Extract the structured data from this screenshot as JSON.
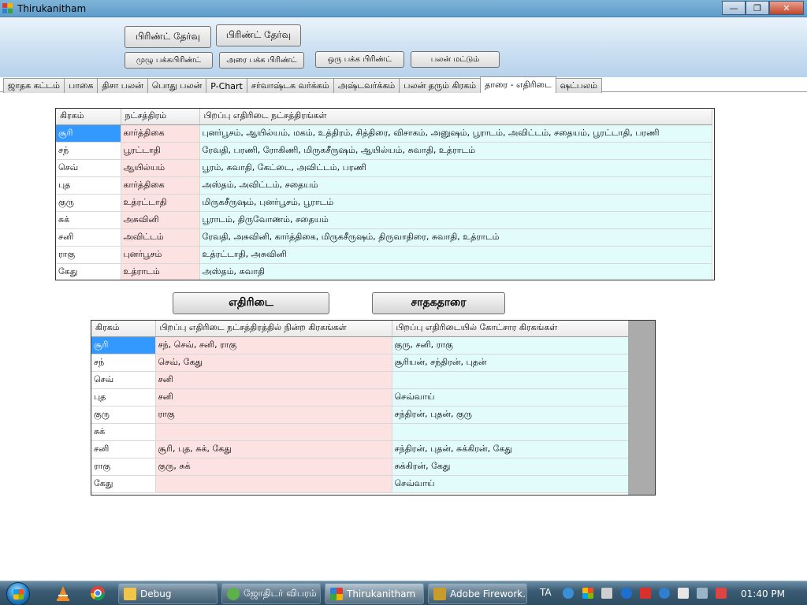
{
  "window": {
    "title": "Thirukanitham"
  },
  "toolbar": {
    "print_select_1": "பிரிண்ட் தேர்வு",
    "print_select_2": "பிரிண்ட் தேர்வு",
    "full_page_print": "முழு பக்கபிரிண்ட்",
    "half_page_print": "அரை பக்க பிரிண்ட்",
    "one_page_print": "ஒரு பக்க பிரிண்ட்",
    "results_only": "பலன் மட்டும்"
  },
  "tabs": [
    {
      "label": "ஜாதக கட்டம்"
    },
    {
      "label": "பாகை"
    },
    {
      "label": "திசா பலன்"
    },
    {
      "label": "பொது பலன்"
    },
    {
      "label": "P-Chart"
    },
    {
      "label": "சர்வாஷ்டக வர்க்கம்"
    },
    {
      "label": "அஷ்டவர்க்கம்"
    },
    {
      "label": "பலன் தரும் கிரகம்"
    },
    {
      "label": "தாரை - எதிரிடை"
    },
    {
      "label": "ஷட்பலம்"
    }
  ],
  "active_tab": "தாரை - எதிரிடை",
  "grid1": {
    "headers": [
      "கிரகம்",
      "நட்சத்திரம்",
      "பிறப்பு எதிரிடை நட்சத்திரங்கள்"
    ],
    "rows": [
      [
        "சூரி",
        "கார்த்திகை",
        "புனர்பூசம், ஆயில்யம், மகம், உத்திரம், சித்திரை, விசாகம், அனுஷம், பூராடம், அவிட்டம், சதையம், பூரட்டாதி, பரணி"
      ],
      [
        "சந்",
        "பூரட்டாதி",
        "ரேவதி, பரணி, ரோகிணி, மிருகசீருஷம், ஆயில்யம், சுவாதி, உத்ராடம்"
      ],
      [
        "செவ்",
        "ஆயில்யம்",
        "பூரம், சுவாதி, கேட்டை, அவிட்டம், பரணி"
      ],
      [
        "புத",
        "கார்த்திகை",
        "அஸ்தம், அவிட்டம், சதையம்"
      ],
      [
        "குரு",
        "உத்ரட்டாதி",
        "மிருகசீருஷம், புனர்பூசம், பூராடம்"
      ],
      [
        "சுக்",
        "அசுவினி",
        "பூராடம், திருவோணம், சதையம்"
      ],
      [
        "சனி",
        "அவிட்டம்",
        "ரேவதி, அசுவினி, கார்த்திகை, மிருகசீருஷம், திருவாதிரை, சுவாதி, உத்ராடம்"
      ],
      [
        "ராகு",
        "புனர்பூசம்",
        "உத்ரட்டாதி, அசுவினி"
      ],
      [
        "கேது",
        "உத்ராடம்",
        "அஸ்தம், சுவாதி"
      ]
    ]
  },
  "buttons": {
    "opposite": "எதிரிடை",
    "favorable_tara": "சாதகதாரை"
  },
  "grid2": {
    "headers": [
      "கிரகம்",
      "பிறப்பு எதிரிடை நட்சத்திரத்தில் நின்ற கிரகங்கள்",
      "பிறப்பு எதிரிடையில் கோட்சார கிரகங்கள்"
    ],
    "rows": [
      [
        "சூரி",
        "சந், செவ், சனி, ராகு",
        "குரு, சனி, ராகு"
      ],
      [
        "சந்",
        "செவ், கேது",
        "சூரியன், சந்திரன், புதன்"
      ],
      [
        "செவ்",
        "சனி",
        ""
      ],
      [
        "புத",
        "சனி",
        "செவ்வாய்"
      ],
      [
        "குரு",
        "ராகு",
        "சந்திரன், புதன், குரு"
      ],
      [
        "சுக்",
        "",
        ""
      ],
      [
        "சனி",
        "சூரி, புத, சுக், கேது",
        "சந்திரன், புதன், சுக்கிரன், கேது"
      ],
      [
        "ராகு",
        "குரு, சுக்",
        "சுக்கிரன், கேது"
      ],
      [
        "கேது",
        "",
        "செவ்வாய்"
      ]
    ]
  },
  "taskbar": {
    "tasks": [
      {
        "label": "Debug"
      },
      {
        "label": "ஜோதிடர் விபரம்"
      },
      {
        "label": "Thirukanitham"
      },
      {
        "label": "Adobe Firework..."
      }
    ],
    "language": "TA",
    "clock": "01:40 PM"
  },
  "colors": {
    "selected_cell": "#3399ff",
    "pink_cell": "#fde2e2",
    "cyan_cell": "#e2fcfc"
  }
}
